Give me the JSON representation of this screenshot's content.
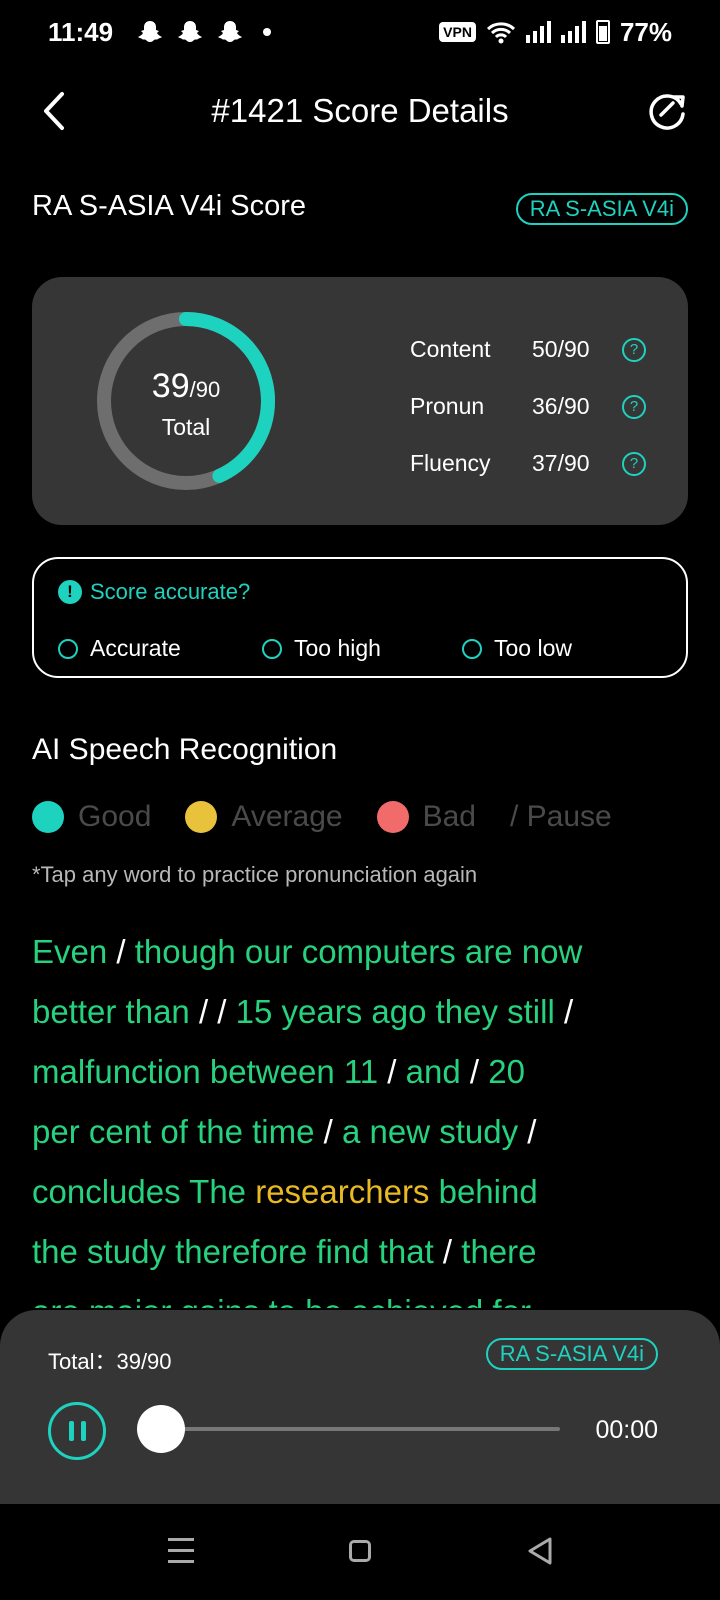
{
  "status_bar": {
    "time": "11:49",
    "vpn": "VPN",
    "battery": "77%"
  },
  "header": {
    "title": "#1421 Score Details"
  },
  "score_section": {
    "title": "RA S-ASIA V4i Score",
    "tag": "RA S-ASIA V4i"
  },
  "score_card": {
    "total_score": "39",
    "total_max": "/90",
    "total_label": "Total",
    "progress_fraction": 0.433,
    "metrics": [
      {
        "name": "Content",
        "value": "50/90"
      },
      {
        "name": "Pronun",
        "value": "36/90"
      },
      {
        "name": "Fluency",
        "value": "37/90"
      }
    ]
  },
  "feedback": {
    "question": "Score accurate?",
    "options": [
      "Accurate",
      "Too high",
      "Too low"
    ]
  },
  "ai_section": {
    "title": "AI Speech Recognition",
    "legend": [
      "Good",
      "Average",
      "Bad",
      "/ Pause"
    ],
    "hint": "*Tap any word to practice pronunciation again"
  },
  "transcript": {
    "lines": [
      [
        {
          "t": "Even",
          "c": "good"
        },
        {
          "t": " / ",
          "c": "pause"
        },
        {
          "t": "though our computers are now",
          "c": "good"
        }
      ],
      [
        {
          "t": "better than",
          "c": "good"
        },
        {
          "t": " / / ",
          "c": "pause"
        },
        {
          "t": "15 years ago they still",
          "c": "good"
        },
        {
          "t": " /",
          "c": "pause"
        }
      ],
      [
        {
          "t": "malfunction between 11",
          "c": "good"
        },
        {
          "t": " / ",
          "c": "pause"
        },
        {
          "t": "and",
          "c": "good"
        },
        {
          "t": " / ",
          "c": "pause"
        },
        {
          "t": "20",
          "c": "good"
        }
      ],
      [
        {
          "t": "per cent of the time",
          "c": "good"
        },
        {
          "t": " / ",
          "c": "pause"
        },
        {
          "t": "a new study",
          "c": "good"
        },
        {
          "t": " /",
          "c": "pause"
        }
      ],
      [
        {
          "t": "concludes The ",
          "c": "good"
        },
        {
          "t": "researchers",
          "c": "average"
        },
        {
          "t": " behind",
          "c": "good"
        }
      ],
      [
        {
          "t": "the study therefore find that",
          "c": "good"
        },
        {
          "t": " / ",
          "c": "pause"
        },
        {
          "t": "there",
          "c": "good"
        }
      ],
      [
        {
          "t": "are major gains to be achieved for",
          "c": "good"
        }
      ]
    ]
  },
  "player": {
    "total": "Total：39/90",
    "tag": "RA S-ASIA V4i",
    "time": "00:00",
    "progress_fraction": 0
  },
  "colors": {
    "accent": "#1ed2c0",
    "good": "#1ed48a",
    "average": "#e8c23a",
    "bad": "#f26b6b",
    "transcript_good": "#27d27e",
    "transcript_average": "#e8b923"
  }
}
